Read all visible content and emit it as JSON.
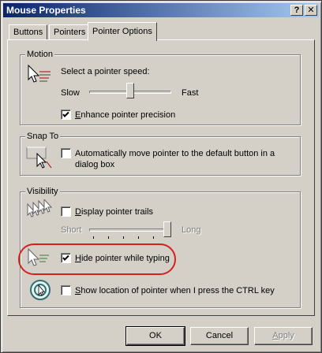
{
  "window": {
    "title": "Mouse Properties",
    "help_label": "?",
    "close_label": "✕"
  },
  "tabs": [
    {
      "label": "Buttons"
    },
    {
      "label": "Pointers"
    },
    {
      "label": "Pointer Options"
    }
  ],
  "motion": {
    "group_label": "Motion",
    "speed_label": "Select a pointer speed:",
    "slow_label": "Slow",
    "fast_label": "Fast",
    "speed_level": 0.5,
    "enhance_label": "Enhance pointer precision",
    "enhance_checked": true
  },
  "snap_to": {
    "group_label": "Snap To",
    "auto_move_label_line1": "Automatically move pointer to the default button in a",
    "auto_move_label_line2": "dialog box",
    "auto_move_checked": false
  },
  "visibility": {
    "group_label": "Visibility",
    "trails_label": "Display pointer trails",
    "trails_checked": false,
    "short_label": "Short",
    "long_label": "Long",
    "trails_level": 1.0,
    "hide_typing_label": "Hide pointer while typing",
    "hide_typing_checked": true,
    "show_ctrl_label": "Show location of pointer when I press the CTRL key",
    "show_ctrl_checked": false
  },
  "buttons": {
    "ok": "OK",
    "cancel": "Cancel",
    "apply": "Apply"
  },
  "colors": {
    "highlight": "#d62020",
    "title_bar": "#0a246a"
  },
  "icons": [
    "pointer-speed-icon",
    "snap-to-icon",
    "pointer-trails-icon",
    "hide-pointer-icon",
    "ctrl-locate-icon"
  ]
}
